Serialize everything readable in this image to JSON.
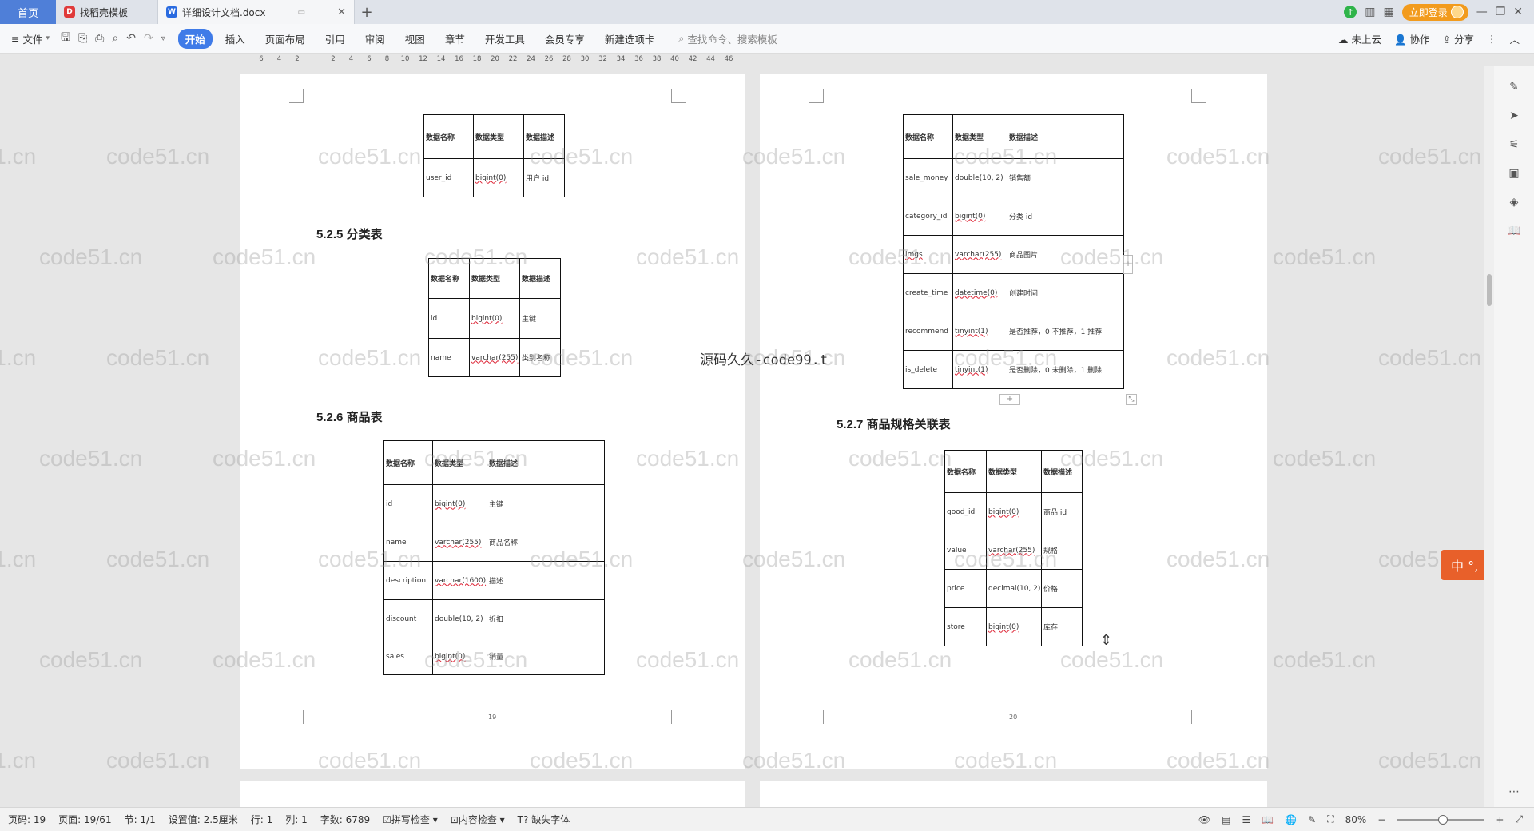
{
  "tabs": {
    "home": "首页",
    "template": "找稻壳模板",
    "document": "详细设计文档.docx"
  },
  "titlebar": {
    "login": "立即登录"
  },
  "ribbon": {
    "file": "文件",
    "menus": [
      "开始",
      "插入",
      "页面布局",
      "引用",
      "审阅",
      "视图",
      "章节",
      "开发工具",
      "会员专享",
      "新建选项卡"
    ],
    "search_placeholder": "查找命令、搜索模板",
    "cloud": "未上云",
    "collab": "协作",
    "share": "分享"
  },
  "ruler": [
    "6",
    "4",
    "2",
    "",
    "2",
    "4",
    "6",
    "8",
    "10",
    "12",
    "14",
    "16",
    "18",
    "20",
    "22",
    "24",
    "26",
    "28",
    "30",
    "32",
    "34",
    "36",
    "38",
    "40",
    "42",
    "44",
    "46"
  ],
  "col_headers": {
    "name": "数据名称",
    "type": "数据类型",
    "desc": "数据描述"
  },
  "page19": {
    "table_top": [
      [
        "user_id",
        "bigint(0)",
        "用户 id"
      ]
    ],
    "heading_525": "5.2.5  分类表",
    "table_category": [
      [
        "id",
        "bigint(0)",
        "主键"
      ],
      [
        "name",
        "varchar(255)",
        "类别名称"
      ]
    ],
    "heading_526": "5.2.6  商品表",
    "table_goods": [
      [
        "id",
        "bigint(0)",
        "主键"
      ],
      [
        "name",
        "varchar(255)",
        "商品名称"
      ],
      [
        "description",
        "varchar(1600)",
        "描述"
      ],
      [
        "discount",
        "double(10, 2)",
        "折扣"
      ],
      [
        "sales",
        "bigint(0)",
        "销量"
      ]
    ],
    "page_number": "19"
  },
  "page20": {
    "table_goods_cont": [
      [
        "sale_money",
        "double(10, 2)",
        "销售额"
      ],
      [
        "category_id",
        "bigint(0)",
        "分类 id"
      ],
      [
        "imgs",
        "varchar(255)",
        "商品图片"
      ],
      [
        "create_time",
        "datetime(0)",
        "创建时间"
      ],
      [
        "recommend",
        "tinyint(1)",
        "是否推荐，0 不推荐，1 推荐"
      ],
      [
        "is_delete",
        "tinyint(1)",
        "是否删除，0 未删除，1 删除"
      ]
    ],
    "heading_527": "5.2.7  商品规格关联表",
    "table_spec": [
      [
        "good_id",
        "bigint(0)",
        "商品 id"
      ],
      [
        "value",
        "varchar(255)",
        "规格"
      ],
      [
        "price",
        "decimal(10, 2)",
        "价格"
      ],
      [
        "store",
        "bigint(0)",
        "库存"
      ]
    ],
    "page_number": "20"
  },
  "overlay_text": "源码久久-code99.t",
  "watermark": "code51.cn",
  "ime": {
    "label": "中 °,",
    "logo": "S"
  },
  "status": {
    "page_code": "页码: 19",
    "page": "页面: 19/61",
    "section": "节: 1/1",
    "setting": "设置值: 2.5厘米",
    "row": "行: 1",
    "col": "列: 1",
    "words": "字数: 6789",
    "spell": "拼写检查",
    "content": "内容检查",
    "missing_font": "缺失字体",
    "zoom": "80%"
  },
  "colors": {
    "accent": "#3f7be8",
    "home_tab": "#4f7fd8",
    "login": "#f29b1d",
    "ime": "#e8602a"
  }
}
